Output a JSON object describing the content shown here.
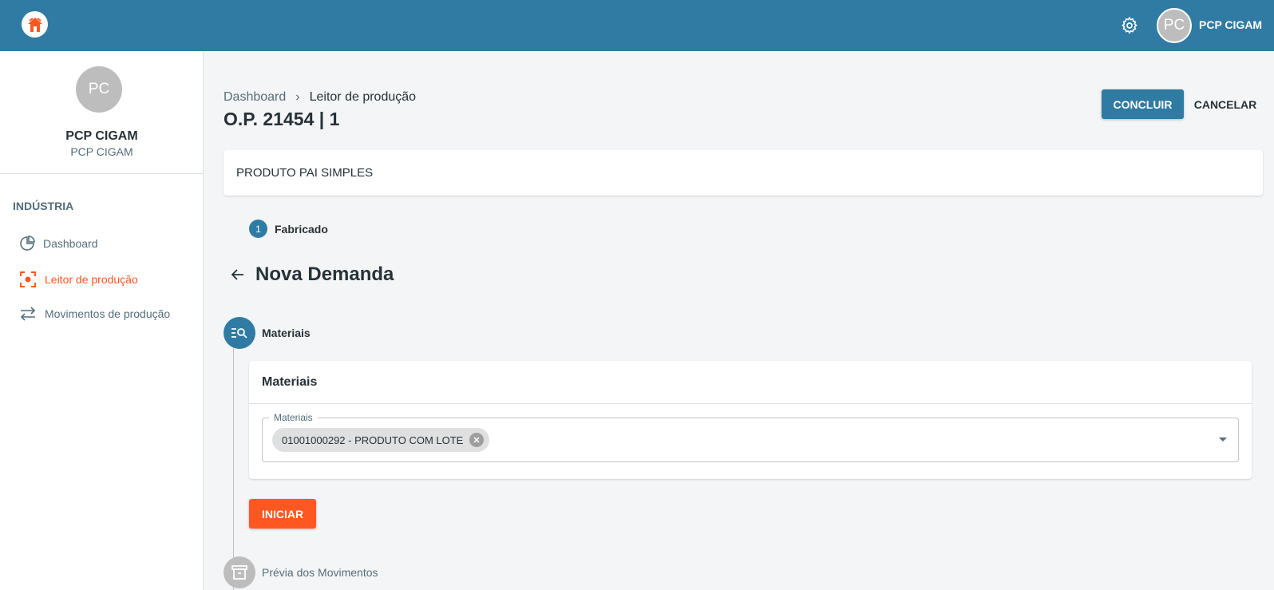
{
  "header": {
    "user_initials": "PC",
    "user_name": "PCP CIGAM"
  },
  "sidebar": {
    "avatar_initials": "PC",
    "user_name": "PCP CIGAM",
    "user_sub": "PCP CIGAM",
    "section": "INDÚSTRIA",
    "items": [
      {
        "label": "Dashboard",
        "icon": "pie-chart-icon"
      },
      {
        "label": "Leitor de produção",
        "icon": "scan-icon",
        "active": true
      },
      {
        "label": "Movimentos de produção",
        "icon": "swap-icon"
      }
    ]
  },
  "breadcrumb": {
    "root": "Dashboard",
    "separator": "›",
    "current": "Leitor de produção"
  },
  "page_title": "O.P. 21454 | 1",
  "actions": {
    "concluir": "CONCLUIR",
    "cancelar": "CANCELAR"
  },
  "product": {
    "name": "PRODUTO PAI SIMPLES"
  },
  "step": {
    "number": "1",
    "label": "Fabricado"
  },
  "demand": {
    "title": "Nova Demanda"
  },
  "stepper": {
    "steps": [
      {
        "label": "Materiais",
        "icon": "list-search-icon"
      },
      {
        "label": "Prévia dos Movimentos",
        "icon": "archive-icon"
      }
    ]
  },
  "materials_card": {
    "title": "Materiais",
    "field_label": "Materiais",
    "chips": [
      "01001000292 - PRODUTO COM LOTE"
    ]
  },
  "iniciar": "INICIAR",
  "colors": {
    "primary": "#2f7ba3",
    "accent": "#ff5722"
  }
}
